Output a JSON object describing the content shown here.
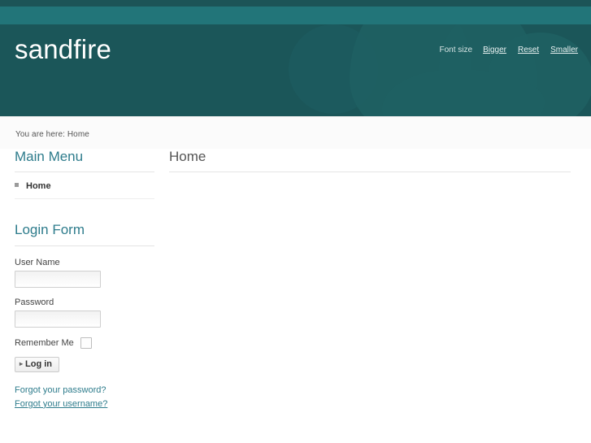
{
  "header": {
    "logo": "sandfire",
    "fontsize": {
      "label": "Font size",
      "bigger": "Bigger",
      "reset": "Reset",
      "smaller": "Smaller"
    },
    "colors": {
      "header_bg": "#1b5659",
      "topbar_light": "#227579",
      "logo_text": "#ffffff",
      "link": "#2e7c8c"
    }
  },
  "breadcrumb": {
    "text": "You are here: Home"
  },
  "sidebar": {
    "main_menu": {
      "title": "Main Menu",
      "items": [
        {
          "label": "Home",
          "bullet": "square-bullet-icon"
        }
      ]
    },
    "login_form": {
      "title": "Login Form",
      "username_label": "User Name",
      "username_value": "",
      "username_placeholder": "",
      "password_label": "Password",
      "password_value": "",
      "password_placeholder": "",
      "remember_label": "Remember Me",
      "remember_checked": false,
      "login_button": "Log in",
      "login_button_icon": "chevron-right-icon",
      "links": [
        {
          "label": "Forgot your password?",
          "hovered": false
        },
        {
          "label": "Forgot your username?",
          "hovered": true
        }
      ]
    }
  },
  "content": {
    "title": "Home"
  }
}
